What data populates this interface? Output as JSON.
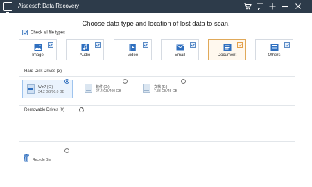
{
  "window": {
    "title": "Aiseesoft Data Recovery",
    "controls": [
      "cart-icon",
      "chat-icon",
      "menu-icon",
      "minimize-icon",
      "close-icon"
    ]
  },
  "main": {
    "heading": "Choose data type and location of lost data to scan.",
    "check_all_label": "Check all file types",
    "check_all_checked": true,
    "file_types": [
      {
        "label": "Image",
        "icon": "image-icon",
        "checked": true,
        "selected": false
      },
      {
        "label": "Audio",
        "icon": "audio-icon",
        "checked": true,
        "selected": false
      },
      {
        "label": "Video",
        "icon": "video-icon",
        "checked": true,
        "selected": false
      },
      {
        "label": "Email",
        "icon": "email-icon",
        "checked": true,
        "selected": false
      },
      {
        "label": "Document",
        "icon": "document-icon",
        "checked": true,
        "selected": true
      },
      {
        "label": "Others",
        "icon": "others-icon",
        "checked": true,
        "selected": false
      }
    ]
  },
  "hard_disk": {
    "label": "Hard Disk Drives (3)",
    "drives": [
      {
        "name": "Win7 (C:)",
        "size": "34.2 GB/90.0 GB",
        "selected": true
      },
      {
        "name": "软件 (D:)",
        "size": "27.4 GB/400 GB",
        "selected": false
      },
      {
        "name": "文档 (E:)",
        "size": "7.33 GB/45 GB",
        "selected": false
      }
    ]
  },
  "removable": {
    "label": "Removable Drives (0)"
  },
  "recycle_bin": {
    "label": "Recycle Bin",
    "selected": false
  },
  "colors": {
    "titlebar": "#2d3b4a",
    "accent": "#2f6fbf",
    "selected_card_border": "#e0a95a"
  }
}
